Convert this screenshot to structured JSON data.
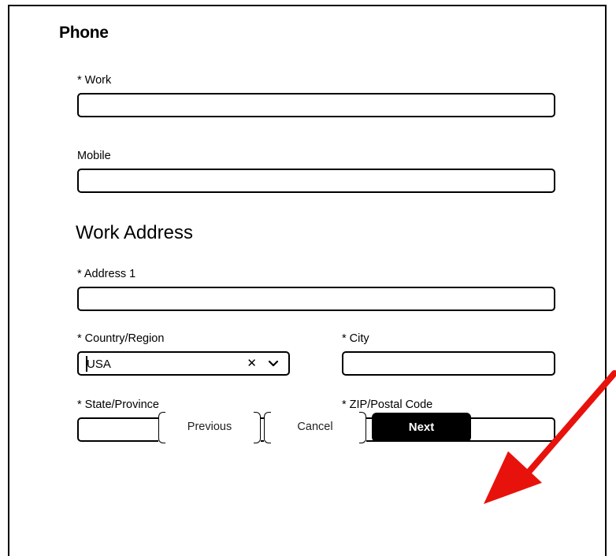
{
  "phone": {
    "title": "Phone",
    "work_label": "* Work",
    "work_value": "",
    "mobile_label": "Mobile",
    "mobile_value": ""
  },
  "address": {
    "title": "Work Address",
    "address1_label": "* Address 1",
    "address1_value": "",
    "country_label": "* Country/Region",
    "country_value": "USA",
    "city_label": "* City",
    "city_value": "",
    "state_label": "* State/Province",
    "state_value": "",
    "zip_label": "* ZIP/Postal Code",
    "zip_value": ""
  },
  "buttons": {
    "previous": "Previous",
    "cancel": "Cancel",
    "next": "Next"
  },
  "icons": {
    "clear": "close-icon",
    "dropdown": "chevron-down-icon",
    "annotation": "red-arrow-icon"
  },
  "colors": {
    "annotation_arrow": "#e8120c",
    "primary_button": "#000000"
  }
}
